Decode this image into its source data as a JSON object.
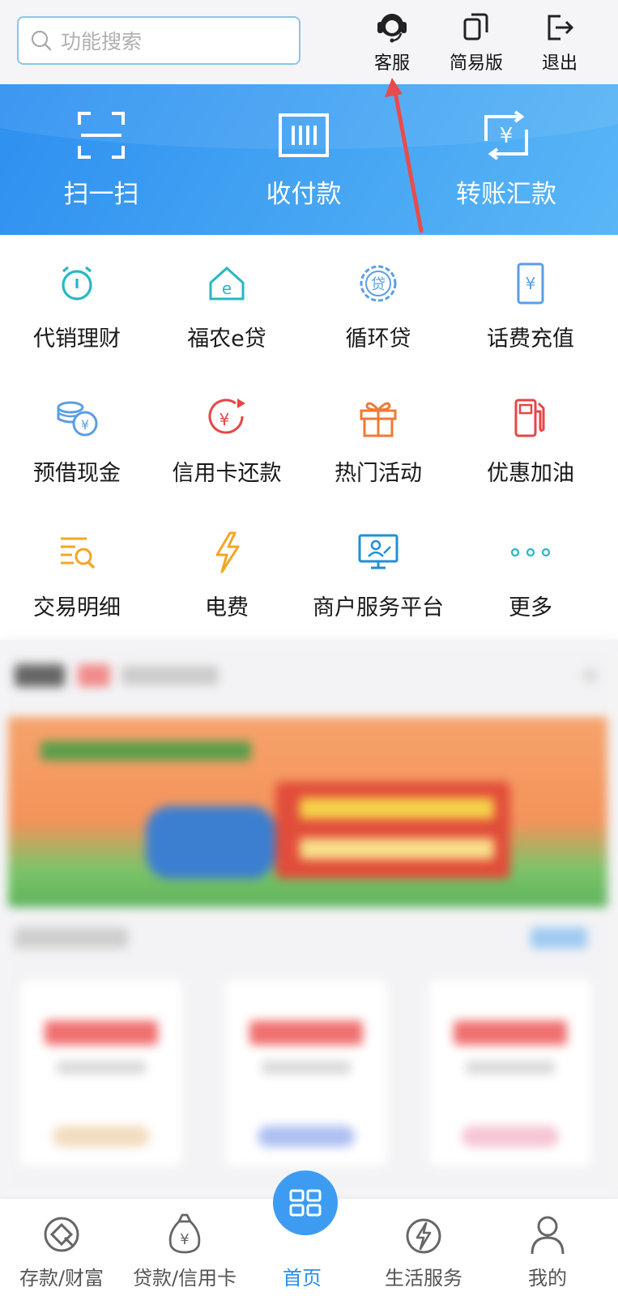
{
  "header": {
    "search_placeholder": "功能搜索",
    "buttons": [
      {
        "label": "客服",
        "icon": "headset-icon"
      },
      {
        "label": "简易版",
        "icon": "copy-icon"
      },
      {
        "label": "退出",
        "icon": "logout-icon"
      }
    ]
  },
  "banner": {
    "items": [
      {
        "label": "扫一扫",
        "icon": "scan-icon"
      },
      {
        "label": "收付款",
        "icon": "barcode-icon"
      },
      {
        "label": "转账汇款",
        "icon": "transfer-icon"
      }
    ]
  },
  "services": [
    {
      "label": "代销理财",
      "icon": "alarm-clock-icon"
    },
    {
      "label": "福农e贷",
      "icon": "house-e-icon"
    },
    {
      "label": "循环贷",
      "icon": "loan-badge-icon"
    },
    {
      "label": "话费充值",
      "icon": "phone-yuan-icon"
    },
    {
      "label": "预借现金",
      "icon": "coins-icon"
    },
    {
      "label": "信用卡还款",
      "icon": "card-repay-icon"
    },
    {
      "label": "热门活动",
      "icon": "gift-icon"
    },
    {
      "label": "优惠加油",
      "icon": "fuel-pump-icon"
    },
    {
      "label": "交易明细",
      "icon": "search-list-icon"
    },
    {
      "label": "电费",
      "icon": "lightning-icon"
    },
    {
      "label": "商户服务平台",
      "icon": "merchant-screen-icon"
    },
    {
      "label": "更多",
      "icon": "more-dots-icon"
    }
  ],
  "bottom_nav": [
    {
      "label": "存款/财富",
      "icon": "deposit-icon"
    },
    {
      "label": "贷款/信用卡",
      "icon": "money-bag-icon"
    },
    {
      "label": "首页",
      "icon": "home-grid-icon",
      "active": true
    },
    {
      "label": "生活服务",
      "icon": "life-service-icon"
    },
    {
      "label": "我的",
      "icon": "user-icon"
    }
  ],
  "colors": {
    "accent": "#2a8ef0",
    "banner_start": "#2d8ff0",
    "banner_end": "#5ab6f6",
    "annotation_arrow": "#e94b4b"
  }
}
